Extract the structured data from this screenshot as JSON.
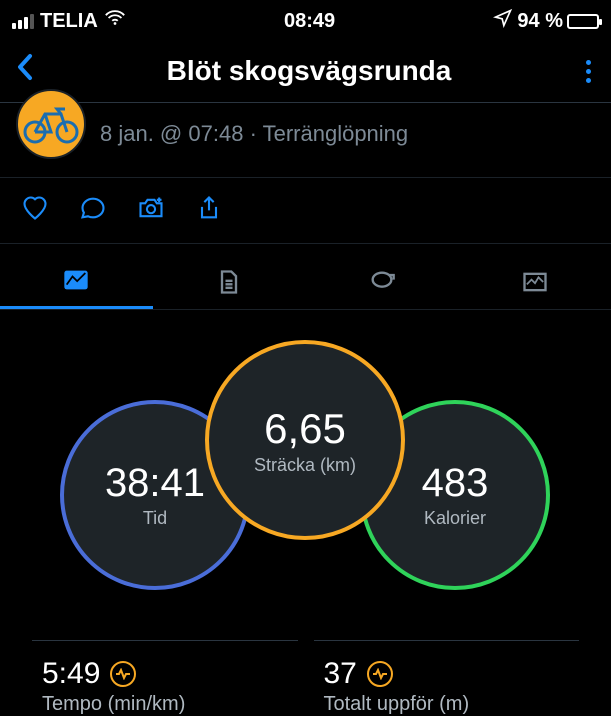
{
  "status": {
    "carrier": "TELIA",
    "time": "08:49",
    "battery_pct": "94 %"
  },
  "header": {
    "title": "Blöt skogsvägsrunda"
  },
  "activity": {
    "date": "8 jan. @ 07:48",
    "type": "Terränglöpning"
  },
  "rings": {
    "center": {
      "value": "6,65",
      "label": "Sträcka (km)"
    },
    "left": {
      "value": "38:41",
      "label": "Tid"
    },
    "right": {
      "value": "483",
      "label": "Kalorier"
    }
  },
  "stats": {
    "pace": {
      "value": "5:49",
      "label": "Tempo (min/km)"
    },
    "ascent": {
      "value": "37",
      "label": "Totalt uppför (m)"
    }
  }
}
